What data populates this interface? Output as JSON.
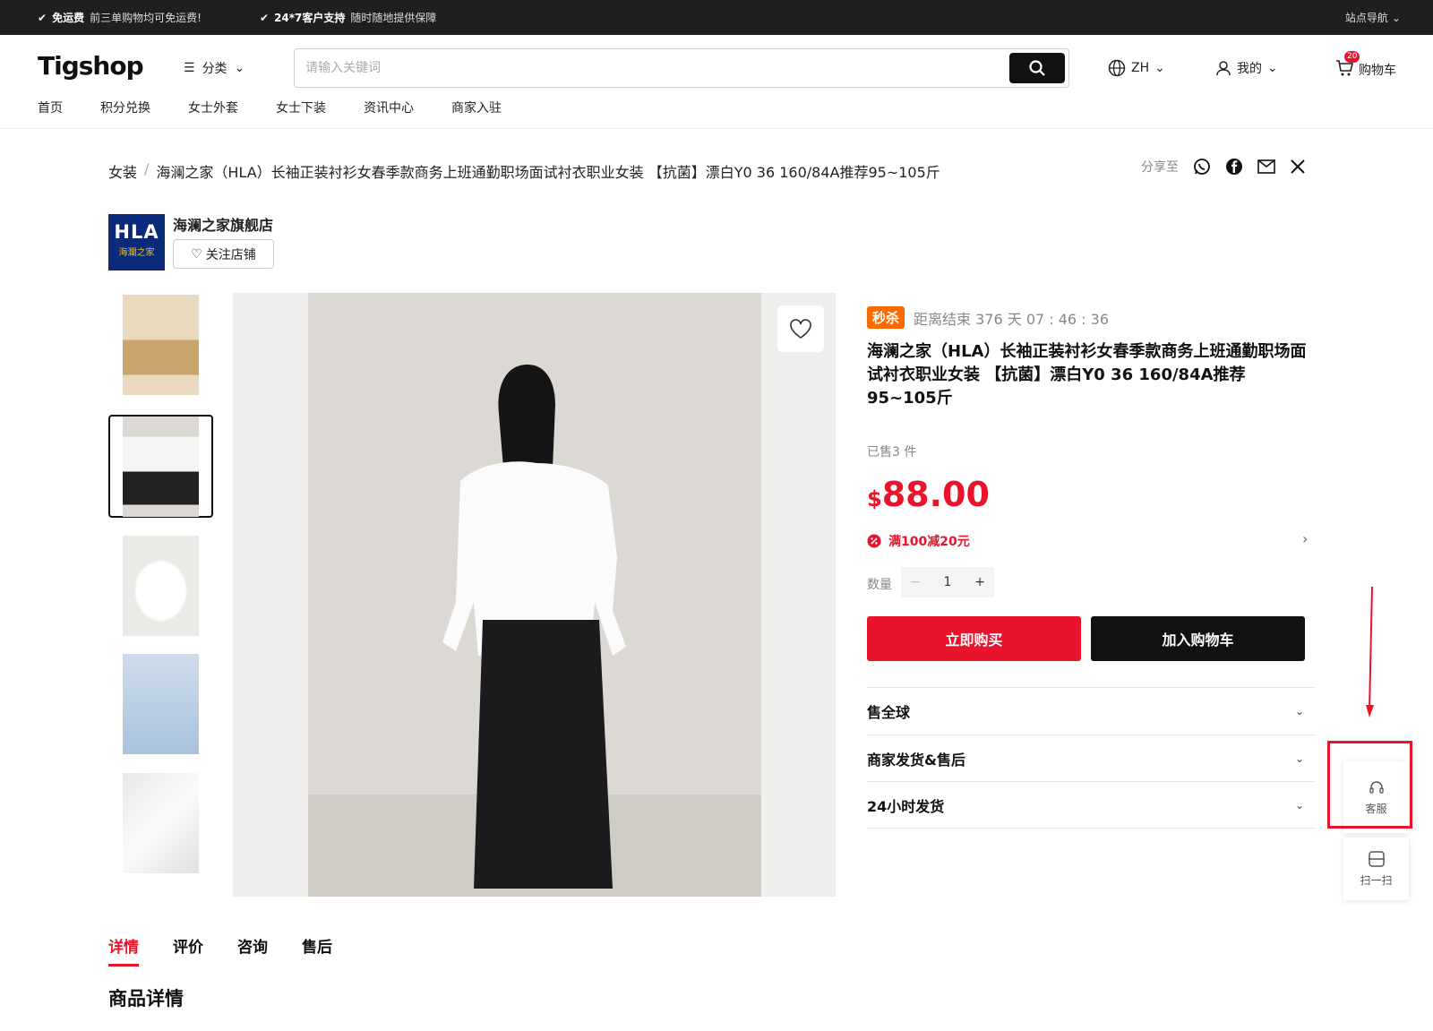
{
  "topbar": {
    "promo1_title": "免运费",
    "promo1_text": "前三单购物均可免运费!",
    "promo2_title": "24*7客户支持",
    "promo2_text": "随时随地提供保障",
    "site_nav": "站点导航"
  },
  "header": {
    "logo": "Tigshop",
    "category": "分类",
    "search_placeholder": "请输入关键词",
    "lang": "ZH",
    "mine": "我的",
    "cart": "购物车",
    "cart_count": "20"
  },
  "nav": [
    "首页",
    "积分兑换",
    "女士外套",
    "女士下装",
    "资讯中心",
    "商家入驻"
  ],
  "breadcrumb": {
    "root": "女装",
    "sep": "/",
    "current": "海澜之家（HLA）长袖正装衬衫女春季款商务上班通勤职场面试衬衣职业女装 【抗菌】漂白Y0 36 160/84A推荐95~105斤"
  },
  "share_label": "分享至",
  "store": {
    "logo_line1": "HLA",
    "logo_line2": "海瀾之家",
    "name": "海澜之家旗舰店",
    "follow": "关注店铺"
  },
  "product": {
    "flash_tag": "秒杀",
    "countdown": "距离结束 376 天 07 : 46 : 36",
    "title": "海澜之家（HLA）长袖正装衬衫女春季款商务上班通勤职场面试衬衣职业女装 【抗菌】漂白Y0 36 160/84A推荐95~105斤",
    "sold": "已售3 件",
    "currency": "$",
    "price": "88.00",
    "promo": "满100减20元",
    "qty_label": "数量",
    "qty_value": "1",
    "buy_now": "立即购买",
    "add_cart": "加入购物车",
    "accordion": [
      "售全球",
      "商家发货&售后",
      "24小时发货"
    ]
  },
  "side": {
    "service": "客服",
    "scan": "扫一扫"
  },
  "tabs": [
    "详情",
    "评价",
    "咨询",
    "售后"
  ],
  "section_title": "商品详情",
  "colors": {
    "accent": "#e8142b",
    "flash": "#ff6a00",
    "dark": "#111111"
  }
}
